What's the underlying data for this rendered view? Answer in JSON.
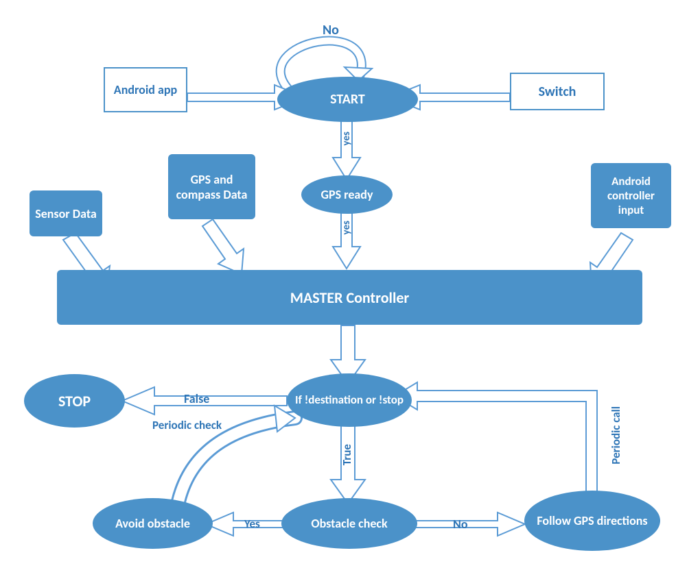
{
  "nodes": {
    "start": "START",
    "android_app": "Android app",
    "switch": "Switch",
    "gps_ready": "GPS ready",
    "gps_compass": "GPS and compass Data",
    "sensor_data": "Sensor Data",
    "android_ctrl": "Android controller input",
    "master": "MASTER Controller",
    "stop": "STOP",
    "decision": "If !destination or   !stop",
    "avoid": "Avoid obstacle",
    "obs_check": "Obstacle check",
    "follow": "Follow GPS directions"
  },
  "labels": {
    "no": "No",
    "yes1": "yes",
    "yes2": "yes",
    "false": "False",
    "true": "True",
    "yes3": "Yes",
    "no2": "No",
    "periodic_check": "Periodic check",
    "periodic_call": "Periodic call"
  },
  "colors": {
    "fill": "#4b92c9",
    "outline": "#4b92c9",
    "text": "#2e75b6",
    "arrow_stroke": "#5b9bd5",
    "arrow_fill": "#ffffff"
  }
}
